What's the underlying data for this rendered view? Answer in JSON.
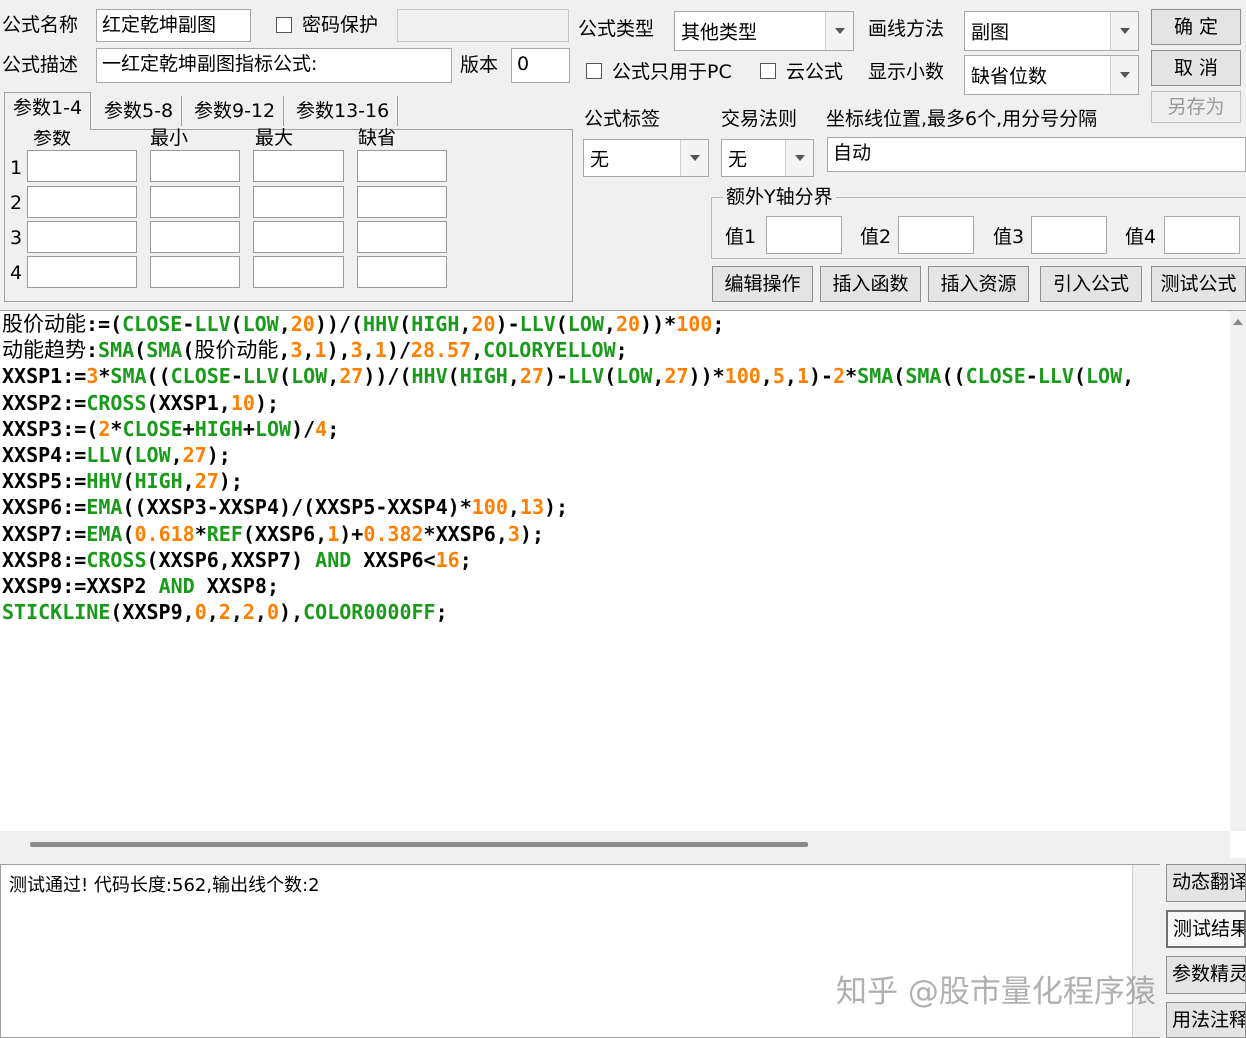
{
  "form": {
    "name_label": "公式名称",
    "name_value": "红定乾坤副图",
    "password_label": "密码保护",
    "password_value": "",
    "desc_label": "公式描述",
    "desc_value": "一红定乾坤副图指标公式:",
    "version_label": "版本",
    "version_value": "0",
    "type_label": "公式类型",
    "type_value": "其他类型",
    "draw_label": "画线方法",
    "draw_value": "副图",
    "pc_only_label": "公式只用于PC",
    "cloud_label": "云公式",
    "decimals_label": "显示小数",
    "decimals_value": "缺省位数",
    "tag_label": "公式标签",
    "tag_value": "无",
    "trade_label": "交易法则",
    "trade_value": "无",
    "axis_label": "坐标线位置,最多6个,用分号分隔",
    "axis_value": "自动",
    "extra_y_label": "额外Y轴分界",
    "values": [
      "值1",
      "值2",
      "值3",
      "值4"
    ]
  },
  "buttons": {
    "ok": "确  定",
    "cancel": "取  消",
    "save_as": "另存为",
    "edit": "编辑操作",
    "insert_func": "插入函数",
    "insert_res": "插入资源",
    "import": "引入公式",
    "test": "测试公式"
  },
  "tabs": [
    "参数1-4",
    "参数5-8",
    "参数9-12",
    "参数13-16"
  ],
  "params_headers": [
    "参数",
    "最小",
    "最大",
    "缺省"
  ],
  "params_rows": [
    "1",
    "2",
    "3",
    "4"
  ],
  "code_lines": [
    "股价动能:=(CLOSE-LLV(LOW,20))/(HHV(HIGH,20)-LLV(LOW,20))*100;",
    "动能趋势:SMA(SMA(股价动能,3,1),3,1)/28.57,COLORYELLOW;",
    "XXSP1:=3*SMA((CLOSE-LLV(LOW,27))/(HHV(HIGH,27)-LLV(LOW,27))*100,5,1)-2*SMA(SMA((CLOSE-LLV(LOW,",
    "XXSP2:=CROSS(XXSP1,10);",
    "XXSP3:=(2*CLOSE+HIGH+LOW)/4;",
    "XXSP4:=LLV(LOW,27);",
    "XXSP5:=HHV(HIGH,27);",
    "XXSP6:=EMA((XXSP3-XXSP4)/(XXSP5-XXSP4)*100,13);",
    "XXSP7:=EMA(0.618*REF(XXSP6,1)+0.382*XXSP6,3);",
    "XXSP8:=CROSS(XXSP6,XXSP7) AND XXSP6<16;",
    "XXSP9:=XXSP2 AND XXSP8;",
    "STICKLINE(XXSP9,0,2,2,0),COLOR0000FF;"
  ],
  "output_text": "测试通过! 代码长度:562,输出线个数:2",
  "side_buttons": [
    "动态翻译",
    "测试结果",
    "参数精灵",
    "用法注释"
  ],
  "watermark": "知乎 @股市量化程序猿",
  "colors": {
    "keyword": "#1a9a1a",
    "number": "#ff8000",
    "default": "#000000"
  }
}
